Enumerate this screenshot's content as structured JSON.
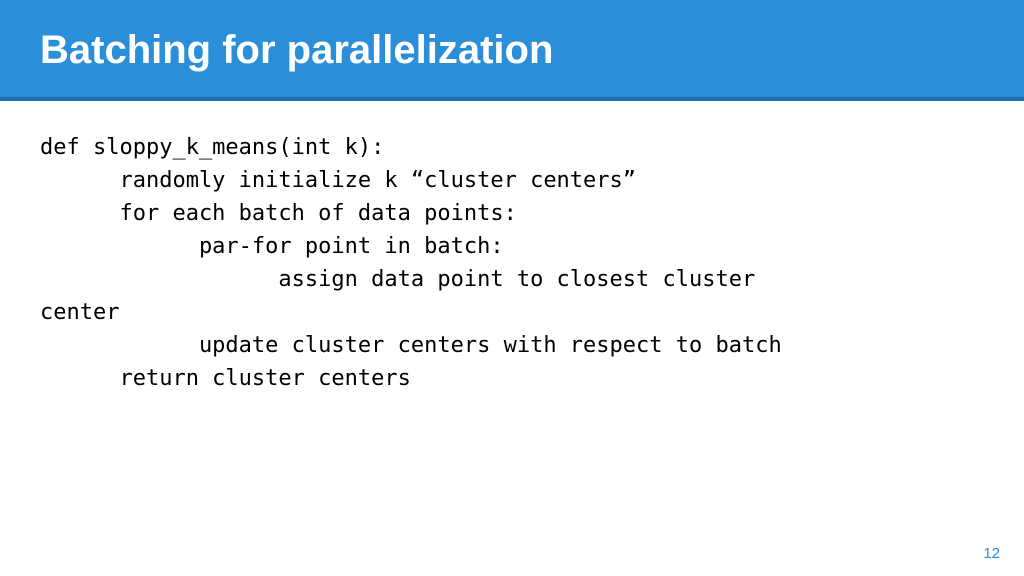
{
  "header": {
    "title": "Batching for parallelization"
  },
  "code": {
    "line1": "def sloppy_k_means(int k):",
    "line2": "      randomly initialize k “cluster centers”",
    "line3": "      for each batch of data points:",
    "line4": "            par-for point in batch:",
    "line5": "                  assign data point to closest cluster",
    "line6": "center",
    "line7": "            update cluster centers with respect to batch",
    "line8": "      return cluster centers"
  },
  "page_number": "12"
}
